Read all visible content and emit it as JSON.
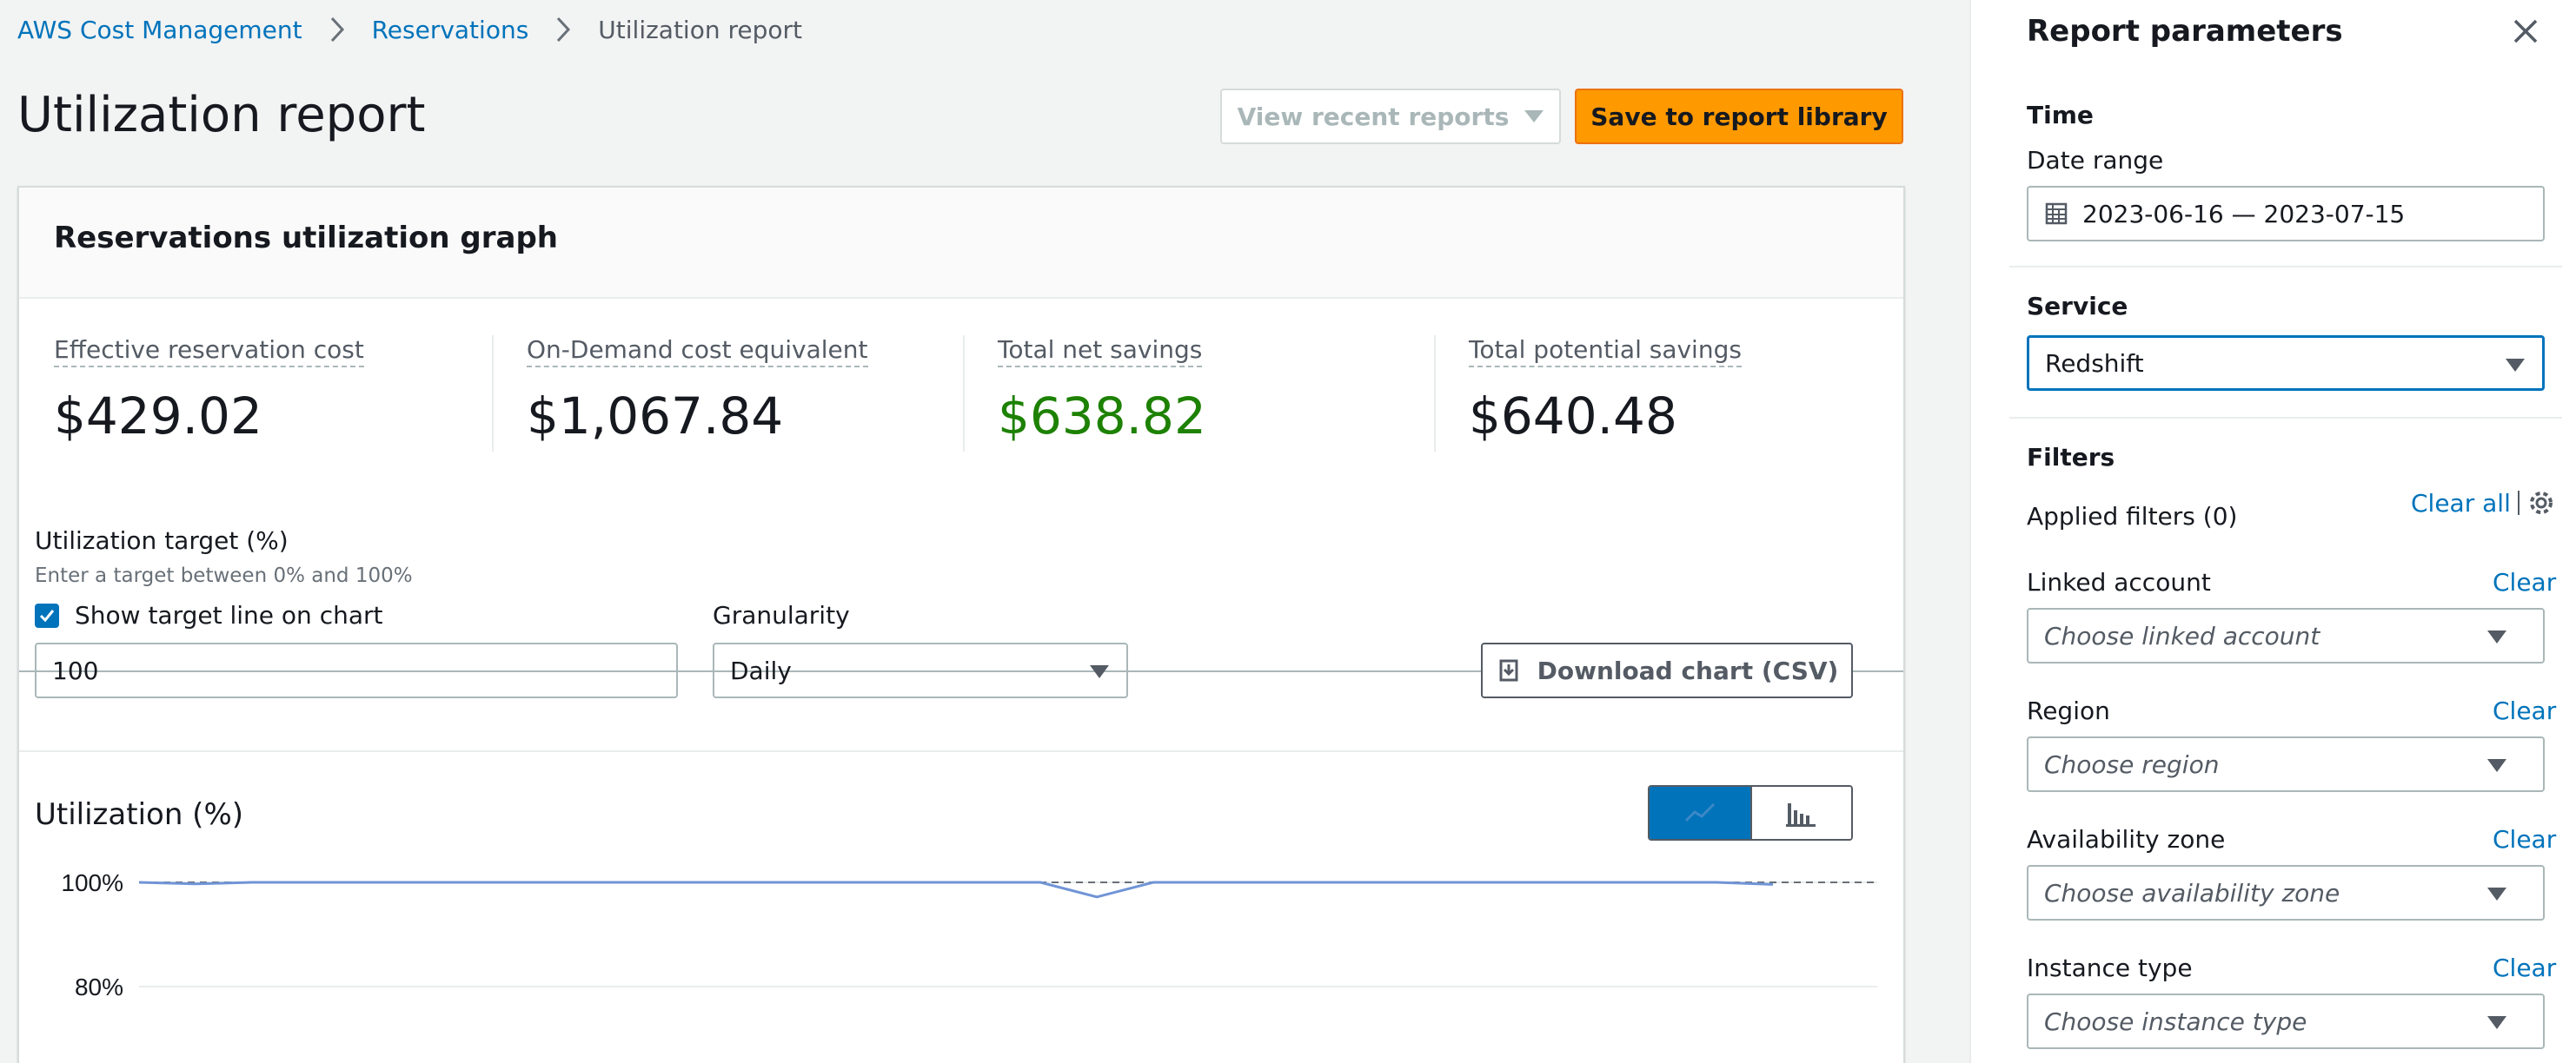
{
  "breadcrumb": {
    "items": [
      "AWS Cost Management",
      "Reservations",
      "Utilization report"
    ]
  },
  "page": {
    "title": "Utilization report",
    "view_recent_label": "View recent reports",
    "save_label": "Save to report library"
  },
  "card": {
    "title": "Reservations utilization graph",
    "metrics": [
      {
        "label": "Effective reservation cost",
        "value": "$429.02"
      },
      {
        "label": "On-Demand cost equivalent",
        "value": "$1,067.84"
      },
      {
        "label": "Total net savings",
        "value": "$638.82"
      },
      {
        "label": "Total potential savings",
        "value": "$640.48"
      }
    ],
    "target_label": "Utilization target (%)",
    "target_desc": "Enter a target between 0% and 100%",
    "show_target_label": "Show target line on chart",
    "target_value": "100",
    "granularity_label": "Granularity",
    "granularity_value": "Daily",
    "download_label": "Download chart (CSV)",
    "utilization_title": "Utilization (%)"
  },
  "chart_data": {
    "type": "line",
    "title": "Utilization (%)",
    "y_tick_labels": [
      "100%",
      "80%"
    ],
    "ylim": [
      76,
      100
    ],
    "series": [
      {
        "values": [
          100,
          99.7,
          100,
          100,
          100,
          100,
          100,
          100,
          100,
          100,
          100,
          100,
          100,
          100,
          100,
          100,
          100,
          97.2,
          100,
          100,
          100,
          100,
          100,
          100,
          100,
          100,
          100,
          100,
          100,
          99.6
        ]
      }
    ],
    "target_line": 100,
    "grid": true,
    "colors": {
      "series": "#7094d6",
      "target": "#687078",
      "grid": "#eaeded"
    }
  },
  "panel": {
    "title": "Report parameters",
    "time_heading": "Time",
    "date_range_label": "Date range",
    "date_range_value": "2023-06-16 — 2023-07-15",
    "service_heading": "Service",
    "service_value": "Redshift",
    "filters_heading": "Filters",
    "applied_filters": "Applied filters (0)",
    "clear_all": "Clear all",
    "clear_label": "Clear",
    "filters": [
      {
        "label": "Linked account",
        "placeholder": "Choose linked account"
      },
      {
        "label": "Region",
        "placeholder": "Choose region"
      },
      {
        "label": "Availability zone",
        "placeholder": "Choose availability zone"
      },
      {
        "label": "Instance type",
        "placeholder": "Choose instance type"
      }
    ]
  },
  "colors": {
    "accent": "#0073bb",
    "primary_button": "#ff9900",
    "savings": "#1d8102"
  }
}
